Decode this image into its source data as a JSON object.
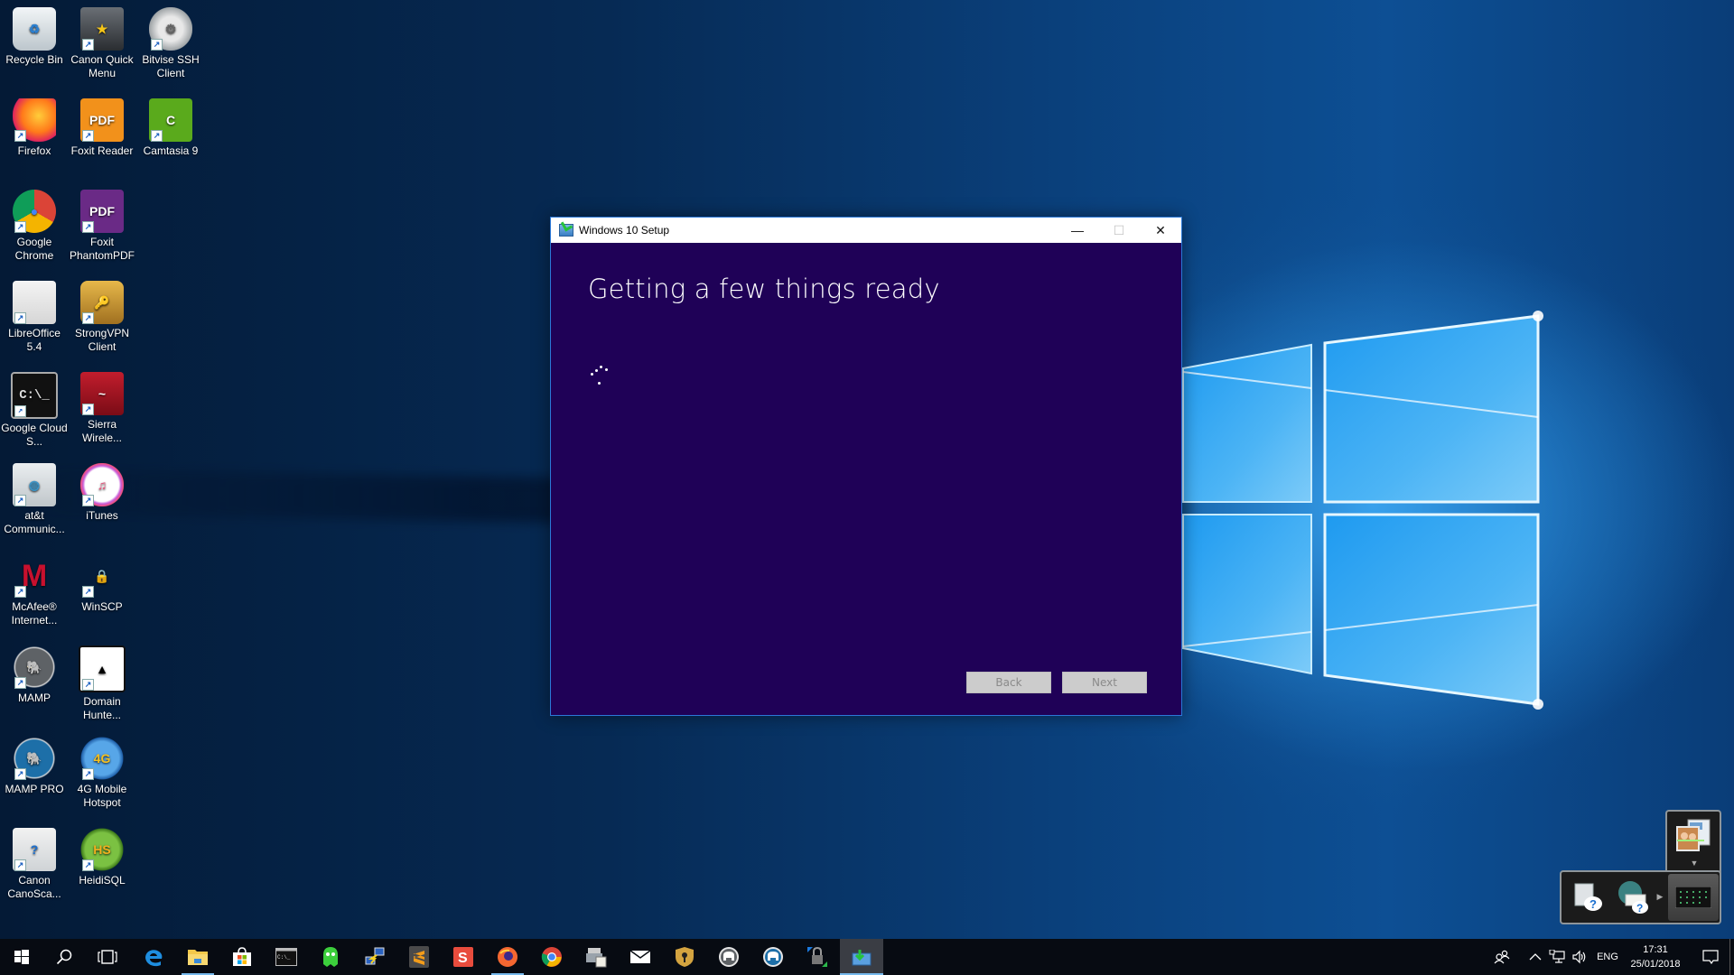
{
  "desktop": {
    "icons": [
      {
        "label": "Recycle Bin",
        "icon": "recycle-bin-icon",
        "shortcut": false
      },
      {
        "label": "Canon Quick Menu",
        "icon": "canon-quick-menu-icon",
        "shortcut": true
      },
      {
        "label": "Bitvise SSH Client",
        "icon": "bitvise-ssh-icon",
        "shortcut": true
      },
      {
        "label": "Firefox",
        "icon": "firefox-icon",
        "shortcut": true
      },
      {
        "label": "Foxit Reader",
        "icon": "foxit-reader-icon",
        "shortcut": true
      },
      {
        "label": "Camtasia 9",
        "icon": "camtasia-icon",
        "shortcut": true
      },
      {
        "label": "Google Chrome",
        "icon": "chrome-icon",
        "shortcut": true
      },
      {
        "label": "Foxit PhantomPDF",
        "icon": "foxit-phantompdf-icon",
        "shortcut": true
      },
      {
        "label": "LibreOffice 5.4",
        "icon": "libreoffice-icon",
        "shortcut": true
      },
      {
        "label": "StrongVPN Client",
        "icon": "strongvpn-icon",
        "shortcut": true
      },
      {
        "label": "Google Cloud S...",
        "icon": "cloud-sdk-shell-icon",
        "shortcut": true
      },
      {
        "label": "Sierra Wirele...",
        "icon": "sierra-wireless-icon",
        "shortcut": true
      },
      {
        "label": "at&t Communic...",
        "icon": "att-icon",
        "shortcut": true
      },
      {
        "label": "iTunes",
        "icon": "itunes-icon",
        "shortcut": true
      },
      {
        "label": "McAfee® Internet...",
        "icon": "mcafee-icon",
        "shortcut": true
      },
      {
        "label": "WinSCP",
        "icon": "winscp-icon",
        "shortcut": true
      },
      {
        "label": "MAMP",
        "icon": "mamp-icon",
        "shortcut": true
      },
      {
        "label": "Domain Hunte...",
        "icon": "domain-hunter-icon",
        "shortcut": true
      },
      {
        "label": "MAMP PRO",
        "icon": "mamp-pro-icon",
        "shortcut": true
      },
      {
        "label": "4G Mobile Hotspot",
        "icon": "mobile-hotspot-icon",
        "shortcut": true
      },
      {
        "label": "Canon CanoSca...",
        "icon": "canon-canoscan-icon",
        "shortcut": true
      },
      {
        "label": "HeidiSQL",
        "icon": "heidisql-icon",
        "shortcut": true
      }
    ]
  },
  "window": {
    "title": "Windows 10 Setup",
    "heading": "Getting a few things ready",
    "minimize_label": "—",
    "maximize_label": "☐",
    "close_label": "✕",
    "back_label": "Back",
    "next_label": "Next",
    "background_color": "#1f0157"
  },
  "taskbar": {
    "start": "start-icon",
    "search": "search-icon",
    "task_view": "task-view-icon",
    "apps": [
      {
        "name": "edge",
        "running": false,
        "active": false
      },
      {
        "name": "file-explorer",
        "running": true,
        "active": false
      },
      {
        "name": "store",
        "running": false,
        "active": false
      },
      {
        "name": "command-prompt",
        "running": false,
        "active": false
      },
      {
        "name": "private-internet-access",
        "running": false,
        "active": false
      },
      {
        "name": "network-connections",
        "running": false,
        "active": false
      },
      {
        "name": "sublime-text",
        "running": false,
        "active": false
      },
      {
        "name": "snagit",
        "running": false,
        "active": false
      },
      {
        "name": "firefox",
        "running": true,
        "active": false
      },
      {
        "name": "chrome",
        "running": false,
        "active": false
      },
      {
        "name": "canon-scanner",
        "running": false,
        "active": false
      },
      {
        "name": "mail",
        "running": false,
        "active": false
      },
      {
        "name": "strongvpn",
        "running": false,
        "active": false
      },
      {
        "name": "mamp",
        "running": false,
        "active": false
      },
      {
        "name": "mamp-pro",
        "running": false,
        "active": false
      },
      {
        "name": "winscp",
        "running": false,
        "active": false
      },
      {
        "name": "windows-10-setup",
        "running": true,
        "active": true
      }
    ],
    "tray": {
      "language": "ENG",
      "time": "17:31",
      "date": "25/01/2018"
    }
  }
}
